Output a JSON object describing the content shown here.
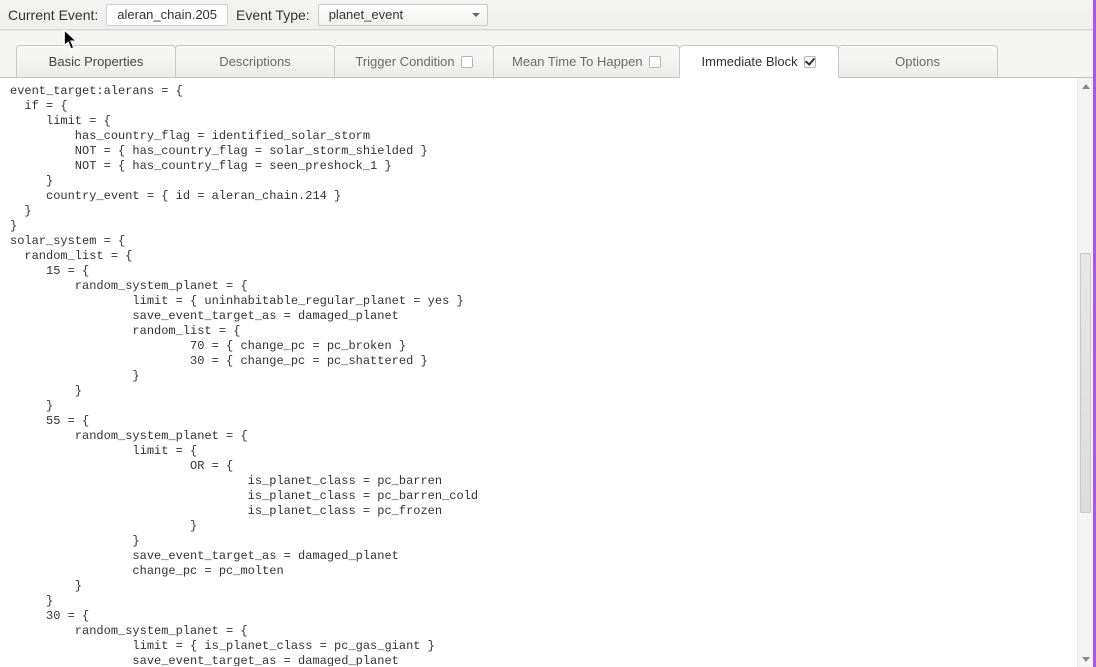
{
  "toolbar": {
    "currentEventLabel": "Current Event:",
    "currentEventValue": "aleran_chain.205",
    "eventTypeLabel": "Event Type:",
    "eventTypeValue": "planet_event"
  },
  "tabs": [
    {
      "label": "Basic Properties",
      "hasCheckbox": false,
      "checked": false,
      "active": false
    },
    {
      "label": "Descriptions",
      "hasCheckbox": false,
      "checked": false,
      "active": false
    },
    {
      "label": "Trigger Condition",
      "hasCheckbox": true,
      "checked": false,
      "active": false
    },
    {
      "label": "Mean Time To Happen",
      "hasCheckbox": true,
      "checked": false,
      "active": false
    },
    {
      "label": "Immediate Block",
      "hasCheckbox": true,
      "checked": true,
      "active": true
    },
    {
      "label": "Options",
      "hasCheckbox": false,
      "checked": false,
      "active": false
    }
  ],
  "code": "event_target:alerans = {\n  if = {\n     limit = {\n         has_country_flag = identified_solar_storm\n         NOT = { has_country_flag = solar_storm_shielded }\n         NOT = { has_country_flag = seen_preshock_1 }\n     }\n     country_event = { id = aleran_chain.214 }\n  }\n}\nsolar_system = {\n  random_list = {\n     15 = {\n         random_system_planet = {\n                 limit = { uninhabitable_regular_planet = yes }\n                 save_event_target_as = damaged_planet\n                 random_list = {\n                         70 = { change_pc = pc_broken }\n                         30 = { change_pc = pc_shattered }\n                 }\n         }\n     }\n     55 = {\n         random_system_planet = {\n                 limit = {\n                         OR = {\n                                 is_planet_class = pc_barren\n                                 is_planet_class = pc_barren_cold\n                                 is_planet_class = pc_frozen\n                         }\n                 }\n                 save_event_target_as = damaged_planet\n                 change_pc = pc_molten\n         }\n     }\n     30 = {\n         random_system_planet = {\n                 limit = { is_planet_class = pc_gas_giant }\n                 save_event_target_as = damaged_planet"
}
